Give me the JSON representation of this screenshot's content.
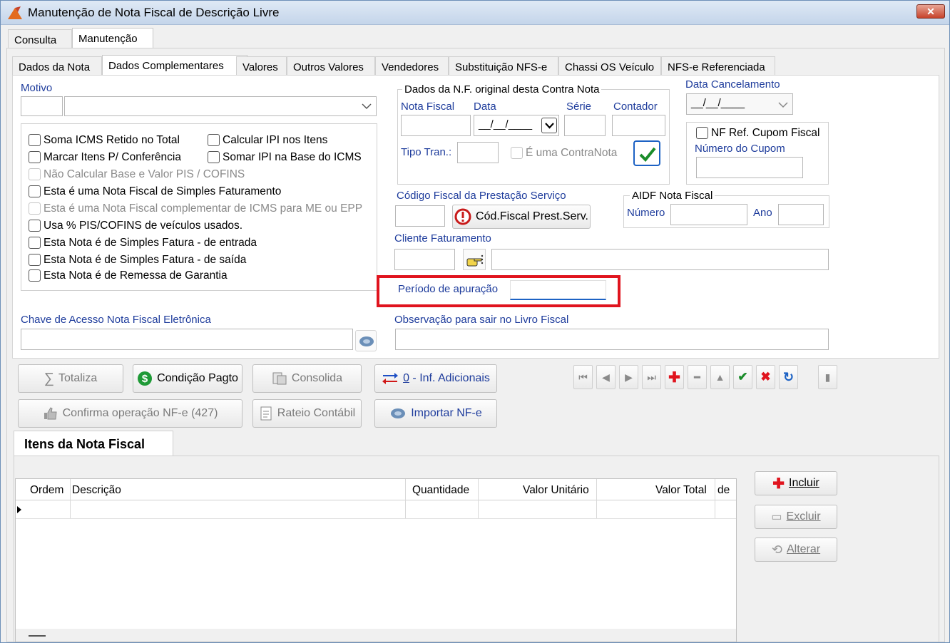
{
  "window": {
    "title": "Manutenção de Nota Fiscal de Descrição Livre",
    "close_label": "✕"
  },
  "main_tabs": [
    {
      "label": "Consulta"
    },
    {
      "label": "Manutenção"
    }
  ],
  "sub_tabs": [
    {
      "label": "Dados da Nota"
    },
    {
      "label": "Dados Complementares"
    },
    {
      "label": "Valores"
    },
    {
      "label": "Outros Valores"
    },
    {
      "label": "Vendedores"
    },
    {
      "label": "Substituição NFS-e"
    },
    {
      "label": "Chassi OS Veículo"
    },
    {
      "label": "NFS-e Referenciada"
    }
  ],
  "motivo": {
    "label": "Motivo",
    "code": "",
    "description": ""
  },
  "checkboxes": [
    {
      "label": "Soma ICMS Retido no Total",
      "enabled": true
    },
    {
      "label": "Calcular IPI nos Itens",
      "enabled": true
    },
    {
      "label": "Marcar Itens P/ Conferência",
      "enabled": true
    },
    {
      "label": "Somar IPI na Base do ICMS",
      "enabled": true
    },
    {
      "label": "Não Calcular Base e Valor PIS / COFINS",
      "enabled": false
    },
    {
      "label": "Esta é uma Nota Fiscal de Simples Faturamento",
      "enabled": true
    },
    {
      "label": "Esta é uma Nota Fiscal complementar de ICMS para ME ou EPP",
      "enabled": false
    },
    {
      "label": "Usa % PIS/COFINS de veículos usados.",
      "enabled": true
    },
    {
      "label": "Esta Nota é de Simples Fatura - de entrada",
      "enabled": true
    },
    {
      "label": "Esta Nota é de Simples Fatura - de saída",
      "enabled": true
    },
    {
      "label": "Esta Nota é de Remessa de Garantia",
      "enabled": true
    }
  ],
  "original_nf": {
    "group_label": "Dados da N.F. original desta Contra Nota",
    "nota_fiscal_label": "Nota Fiscal",
    "data_label": "Data",
    "serie_label": "Série",
    "contador_label": "Contador",
    "data_value": "__/__/____",
    "tipo_tran_label": "Tipo Tran.:",
    "contranota_label": "É uma ContraNota"
  },
  "cancelamento": {
    "label": "Data Cancelamento",
    "value": "__/__/____"
  },
  "cupom": {
    "checkbox_label": "NF Ref. Cupom Fiscal",
    "numero_label": "Número do Cupom"
  },
  "codigo_fiscal": {
    "label": "Código Fiscal da Prestação Serviço",
    "button_label": "Cód.Fiscal Prest.Serv."
  },
  "aidf": {
    "group_label": "AIDF Nota Fiscal",
    "numero_label": "Número",
    "ano_label": "Ano"
  },
  "cliente": {
    "label": "Cliente Faturamento"
  },
  "periodo": {
    "label": "Período de apuração",
    "value": ""
  },
  "chave": {
    "label": "Chave de Acesso Nota Fiscal Eletrônica"
  },
  "observacao": {
    "label": "Observação para sair no Livro Fiscal"
  },
  "actions": {
    "totaliza": "Totaliza",
    "condicao": "Condição Pagto",
    "consolida": "Consolida",
    "inf_prefix": "0",
    "inf_suffix": " - Inf. Adicionais",
    "confirma": "Confirma operação NF-e (427)",
    "rateio": "Rateio Contábil",
    "importar": "Importar NF-e"
  },
  "items": {
    "tab_label": "Itens da Nota Fiscal",
    "columns": [
      "Ordem",
      "Descrição",
      "Quantidade",
      "Valor Unitário",
      "Valor Total",
      "de"
    ],
    "incluir": "Incluir",
    "excluir": "Excluir",
    "alterar": "Alterar"
  },
  "colors": {
    "accent_blue": "#1e3c9c",
    "highlight_red": "#e0141e",
    "confirm_green": "#1a8c2a"
  }
}
